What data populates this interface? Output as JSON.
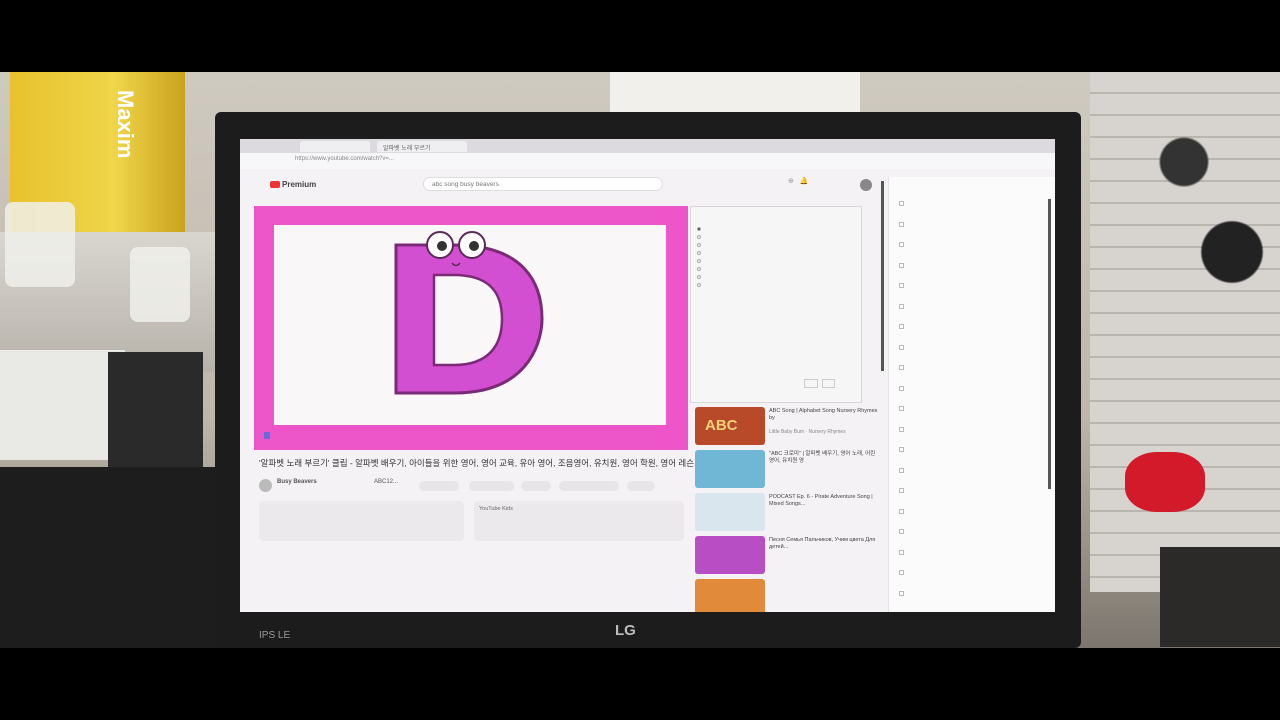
{
  "scene": {
    "background_colors": {
      "video_border": "#ec56c8",
      "letter": "#d14fd0",
      "caption_highlight": "#6b68d9"
    }
  },
  "monitor": {
    "brand": "LG",
    "panel_label": "IPS LE"
  },
  "browser": {
    "tabs": [
      "",
      "알파벳 노래 부르기"
    ],
    "url": "https://www.youtube.com/watch?v=..."
  },
  "youtube": {
    "logo": "Premium",
    "search_value": "abc song busy beavers",
    "video": {
      "letter": "D",
      "caption_prefix": "",
      "caption_highlight": ""
    },
    "title": "'알파벳 노래 부르기' 클립 - 알파벳 배우기, 아이들을 위한 영어, 영어 교육, 유아 영어, 조음영어, 유치원, 영어 학원, 영어 레슨.",
    "channel": "Busy Beavers",
    "channel_suffix": "ABC12...",
    "kids_label": "YouTube Kids",
    "comments_note": ""
  },
  "popup": {
    "title": "",
    "options_count_note": ""
  },
  "recommendations": [
    {
      "title": "ABC Song | Alphabet Song Nursery Rhymes by",
      "meta": "Little Baby Bum · Nursery Rhymes",
      "thumb_color": "#b84a2a",
      "thumb_label": "ABC"
    },
    {
      "title": "\"ABC 크로미\" | 알파벳 배우기, 영어 노래, 어린 영어, 유치원 영",
      "meta": "",
      "thumb_color": "#6fb7d4",
      "thumb_label": ""
    },
    {
      "title": "PODCAST Ep. 6 - Pirate Adventure Song | Mixed Songs...",
      "meta": "",
      "thumb_color": "#d9e6ee",
      "thumb_label": ""
    },
    {
      "title": "Песня Семья Пальчиков, Учим цвета Для детей...",
      "meta": "",
      "thumb_color": "#b84ec3",
      "thumb_label": ""
    },
    {
      "title": "",
      "meta": "",
      "thumb_color": "#e08a3a",
      "thumb_label": ""
    }
  ],
  "sidepanel": {
    "title": "",
    "items": [
      "",
      "",
      "",
      "",
      "",
      "",
      "",
      "",
      "",
      "",
      "",
      "",
      "",
      "",
      "",
      "",
      "",
      "",
      "",
      ""
    ]
  }
}
